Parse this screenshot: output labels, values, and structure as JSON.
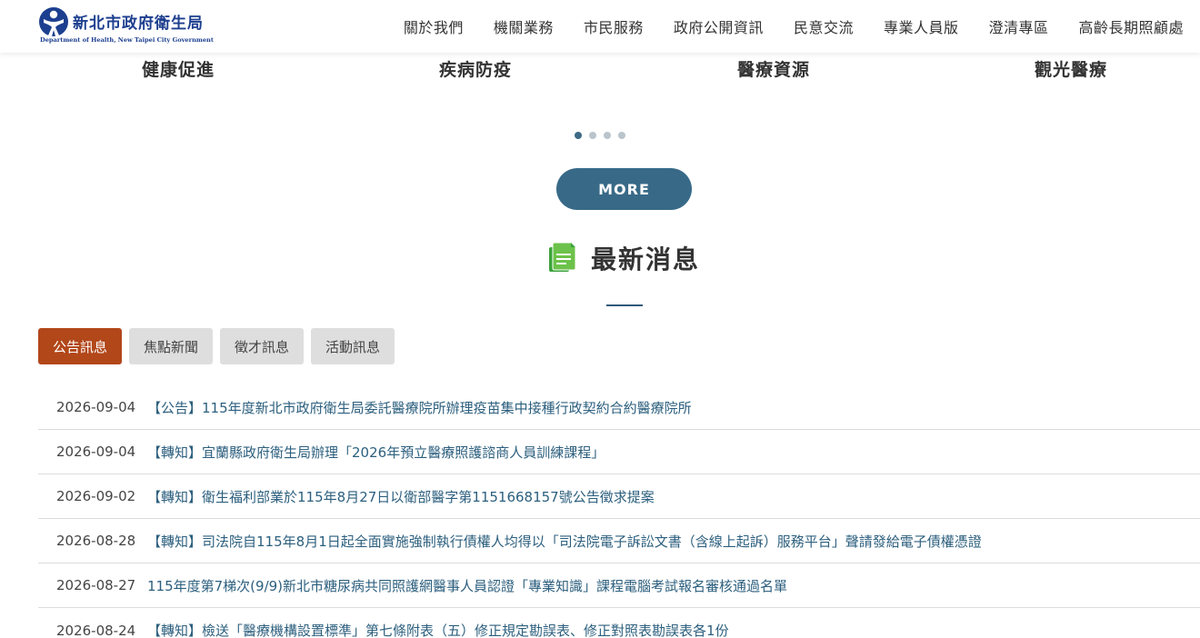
{
  "header": {
    "logo_cn": "新北市政府衛生局",
    "logo_en": "Department of Health, New Taipei City Government",
    "nav": [
      "關於我們",
      "機關業務",
      "市民服務",
      "政府公開資訊",
      "民意交流",
      "專業人員版",
      "澄清專區",
      "高齡長期照顧處"
    ]
  },
  "categories": [
    "健康促進",
    "疾病防疫",
    "醫療資源",
    "觀光醫療"
  ],
  "carousel": {
    "pages": 4,
    "active": 0
  },
  "more_label": "MORE",
  "news": {
    "title": "最新消息",
    "tabs": [
      "公告訊息",
      "焦點新聞",
      "徵才訊息",
      "活動訊息"
    ],
    "active_tab": 0,
    "items": [
      {
        "date": "2026-09-04",
        "tag": "【公告】",
        "text": "115年度新北市政府衛生局委託醫療院所辦理疫苗集中接種行政契約合約醫療院所"
      },
      {
        "date": "2026-09-04",
        "tag": "【轉知】",
        "text": "宜蘭縣政府衛生局辦理「2026年預立醫療照護諮商人員訓練課程」"
      },
      {
        "date": "2026-09-02",
        "tag": "【轉知】",
        "text": "衛生福利部業於115年8月27日以衛部醫字第1151668157號公告徵求提案"
      },
      {
        "date": "2026-08-28",
        "tag": "【轉知】",
        "text": "司法院自115年8月1日起全面實施強制執行債權人均得以「司法院電子訴訟文書（含線上起訴）服務平台」聲請發給電子債權憑證"
      },
      {
        "date": "2026-08-27",
        "tag": "",
        "text": "115年度第7梯次(9/9)新北市糖尿病共同照護網醫事人員認證「專業知識」課程電腦考試報名審核通過名單"
      },
      {
        "date": "2026-08-24",
        "tag": "【轉知】",
        "text": "檢送「醫療機構設置標準」第七條附表（五）修正規定勘誤表、修正對照表勘誤表各1份"
      }
    ]
  },
  "colors": {
    "primary": "#386a88",
    "active_tab": "#b2471a",
    "link": "#2c5f7e",
    "logo": "#1d3f8f",
    "icon_green": "#3aa33a"
  }
}
